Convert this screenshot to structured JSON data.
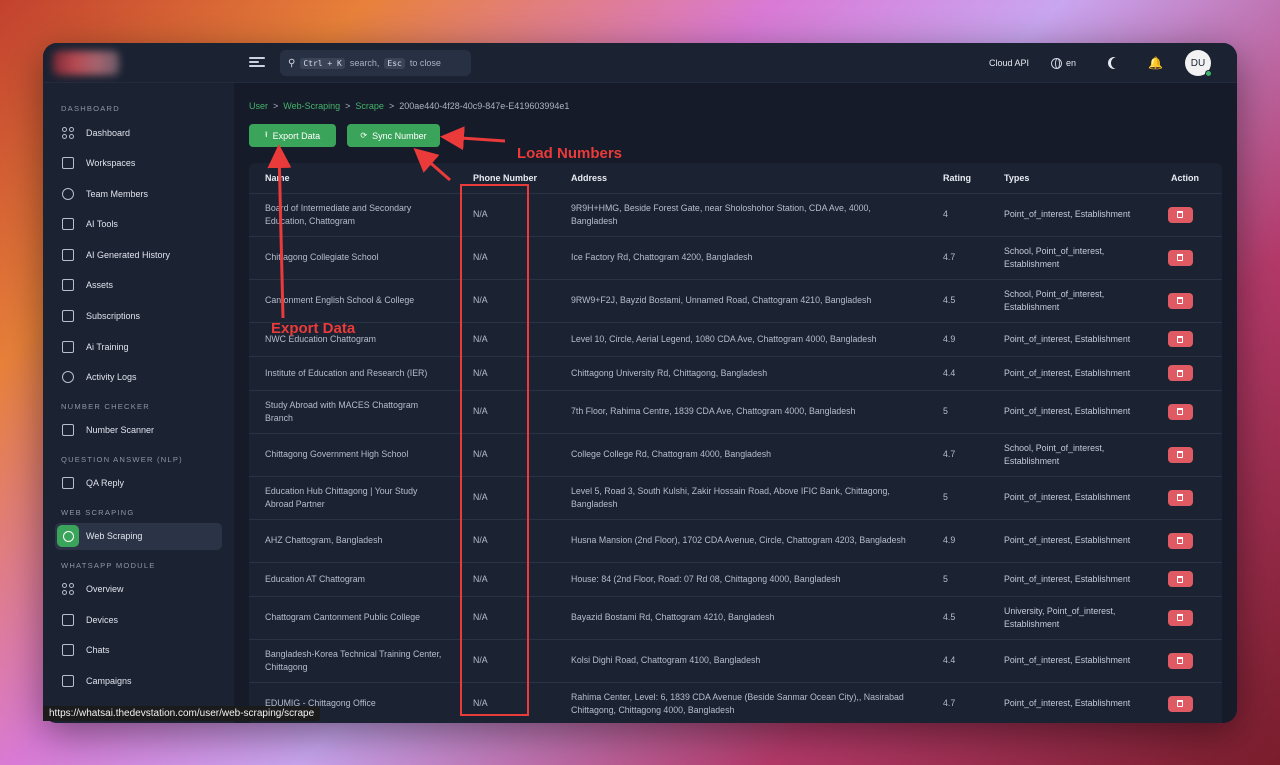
{
  "topbar": {
    "search_placeholder_pre": "search,",
    "search_kbd1": "Ctrl + K",
    "search_kbd2": "Esc",
    "search_placeholder_post": "to close",
    "cloud_api": "Cloud API",
    "language": "en",
    "avatar_initials": "DU"
  },
  "sidebar": {
    "sections": [
      {
        "title": "DASHBOARD",
        "items": [
          {
            "label": "Dashboard",
            "icon": "dashboard-icon"
          },
          {
            "label": "Workspaces",
            "icon": "workspaces-icon"
          },
          {
            "label": "Team Members",
            "icon": "user-icon"
          },
          {
            "label": "AI Tools",
            "icon": "robot-icon"
          },
          {
            "label": "AI Generated History",
            "icon": "history-icon"
          },
          {
            "label": "Assets",
            "icon": "image-icon"
          },
          {
            "label": "Subscriptions",
            "icon": "card-icon"
          },
          {
            "label": "Ai Training",
            "icon": "training-icon"
          },
          {
            "label": "Activity Logs",
            "icon": "clock-icon"
          }
        ]
      },
      {
        "title": "NUMBER CHECKER",
        "items": [
          {
            "label": "Number Scanner",
            "icon": "scanner-icon"
          }
        ]
      },
      {
        "title": "QUESTION ANSWER (NLP)",
        "items": [
          {
            "label": "QA Reply",
            "icon": "reply-icon"
          }
        ]
      },
      {
        "title": "WEB SCRAPING",
        "items": [
          {
            "label": "Web Scraping",
            "icon": "globe-icon",
            "active": true
          }
        ]
      },
      {
        "title": "WHATSAPP MODULE",
        "items": [
          {
            "label": "Overview",
            "icon": "overview-icon"
          },
          {
            "label": "Devices",
            "icon": "devices-icon"
          },
          {
            "label": "Chats",
            "icon": "chat-icon"
          },
          {
            "label": "Campaigns",
            "icon": "campaign-icon"
          }
        ]
      }
    ]
  },
  "breadcrumb": {
    "user": "User",
    "web_scraping": "Web-Scraping",
    "scrape": "Scrape",
    "id": "200ae440-4f28-40c9-847e-E419603994e1",
    "sep": ">"
  },
  "actions": {
    "export": "Export Data",
    "sync": "Sync Number"
  },
  "table": {
    "headers": [
      "Name",
      "Phone Number",
      "Address",
      "Rating",
      "Types",
      "Action"
    ],
    "rows": [
      {
        "name": "Board of Intermediate and Secondary Education, Chattogram",
        "phone": "N/A",
        "address": "9R9H+HMG, Beside Forest Gate, near Sholoshohor Station, CDA Ave, 4000, Bangladesh",
        "rating": "4",
        "types": "Point_of_interest, Establishment"
      },
      {
        "name": "Chittagong Collegiate School",
        "phone": "N/A",
        "address": "Ice Factory Rd, Chattogram 4200, Bangladesh",
        "rating": "4.7",
        "types": "School, Point_of_interest, Establishment"
      },
      {
        "name": "Cantonment English School & College",
        "phone": "N/A",
        "address": "9RW9+F2J, Bayzid Bostami, Unnamed Road, Chattogram 4210, Bangladesh",
        "rating": "4.5",
        "types": "School, Point_of_interest, Establishment"
      },
      {
        "name": "NWC Education Chattogram",
        "phone": "N/A",
        "address": "Level 10, Circle, Aerial Legend, 1080 CDA Ave, Chattogram 4000, Bangladesh",
        "rating": "4.9",
        "types": "Point_of_interest, Establishment"
      },
      {
        "name": "Institute of Education and Research (IER)",
        "phone": "N/A",
        "address": "Chittagong University Rd, Chittagong, Bangladesh",
        "rating": "4.4",
        "types": "Point_of_interest, Establishment"
      },
      {
        "name": "Study Abroad with MACES Chattogram Branch",
        "phone": "N/A",
        "address": "7th Floor, Rahima Centre, 1839 CDA Ave, Chattogram 4000, Bangladesh",
        "rating": "5",
        "types": "Point_of_interest, Establishment"
      },
      {
        "name": "Chittagong Government High School",
        "phone": "N/A",
        "address": "College College Rd, Chattogram 4000, Bangladesh",
        "rating": "4.7",
        "types": "School, Point_of_interest, Establishment"
      },
      {
        "name": "Education Hub Chittagong | Your Study Abroad Partner",
        "phone": "N/A",
        "address": "Level 5, Road 3, South Kulshi, Zakir Hossain Road, Above IFIC Bank, Chittagong, Bangladesh",
        "rating": "5",
        "types": "Point_of_interest, Establishment"
      },
      {
        "name": "AHZ Chattogram, Bangladesh",
        "phone": "N/A",
        "address": "Husna Mansion (2nd Floor), 1702 CDA Avenue, Circle, Chattogram 4203, Bangladesh",
        "rating": "4.9",
        "types": "Point_of_interest, Establishment"
      },
      {
        "name": "Education AT Chattogram",
        "phone": "N/A",
        "address": "House: 84 (2nd Floor, Road: 07 Rd 08, Chittagong 4000, Bangladesh",
        "rating": "5",
        "types": "Point_of_interest, Establishment"
      },
      {
        "name": "Chattogram Cantonment Public College",
        "phone": "N/A",
        "address": "Bayazid Bostami Rd, Chattogram 4210, Bangladesh",
        "rating": "4.5",
        "types": "University, Point_of_interest, Establishment"
      },
      {
        "name": "Bangladesh-Korea Technical Training Center, Chittagong",
        "phone": "N/A",
        "address": "Kolsi Dighi Road, Chattogram 4100, Bangladesh",
        "rating": "4.4",
        "types": "Point_of_interest, Establishment"
      },
      {
        "name": "EDUMIG - Chittagong Office",
        "phone": "N/A",
        "address": "Rahima Center, Level: 6, 1839 CDA Avenue (Beside Sanmar Ocean City),, Nasirabad Chittagong, Chittagong 4000, Bangladesh",
        "rating": "4.7",
        "types": "Point_of_interest, Establishment"
      }
    ]
  },
  "annotations": {
    "load_numbers": "Load Numbers",
    "export_data": "Export Data",
    "color": "#ea3a3a"
  },
  "status_url": "https://whatsai.thedevstation.com/user/web-scraping/scrape"
}
